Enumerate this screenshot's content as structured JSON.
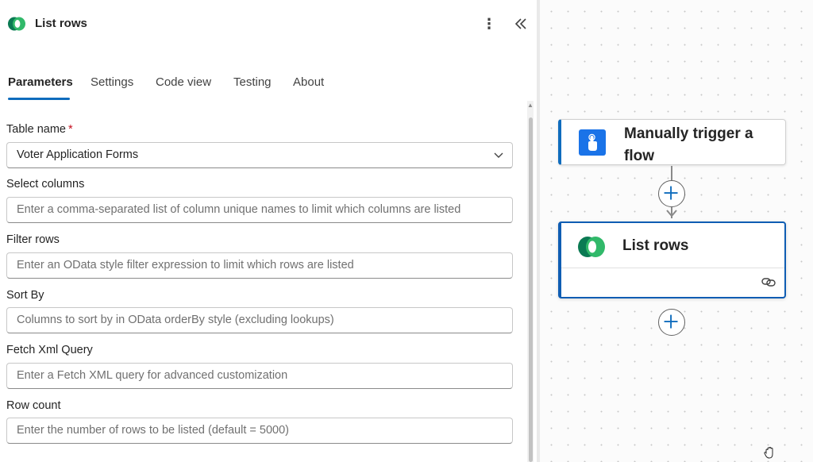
{
  "panel": {
    "title": "List rows",
    "icon": "dataverse-logo",
    "more_icon": "more-vertical-icon",
    "collapse_icon": "double-chevron-left-icon"
  },
  "tabs": [
    {
      "label": "Parameters",
      "active": true
    },
    {
      "label": "Settings",
      "active": false
    },
    {
      "label": "Code view",
      "active": false
    },
    {
      "label": "Testing",
      "active": false
    },
    {
      "label": "About",
      "active": false
    }
  ],
  "form": {
    "table_name": {
      "label": "Table name",
      "required_mark": "*",
      "value": "Voter Application Forms"
    },
    "select_columns": {
      "label": "Select columns",
      "placeholder": "Enter a comma-separated list of column unique names to limit which columns are listed"
    },
    "filter_rows": {
      "label": "Filter rows",
      "placeholder": "Enter an OData style filter expression to limit which rows are listed"
    },
    "sort_by": {
      "label": "Sort By",
      "placeholder": "Columns to sort by in OData orderBy style (excluding lookups)"
    },
    "fetch_xml": {
      "label": "Fetch Xml Query",
      "placeholder": "Enter a Fetch XML query for advanced customization"
    },
    "row_count": {
      "label": "Row count",
      "placeholder": "Enter the number of rows to be listed (default = 5000)"
    }
  },
  "canvas": {
    "trigger_card": {
      "title": "Manually trigger a flow",
      "icon": "touch-hand-icon"
    },
    "list_card": {
      "title": "List rows",
      "icon": "dataverse-logo",
      "footer_icon": "link-icon"
    },
    "colors": {
      "accent": "#0f6cbd",
      "selected_border": "#0f5db3",
      "trigger_icon_bg": "#1a73e8"
    }
  }
}
